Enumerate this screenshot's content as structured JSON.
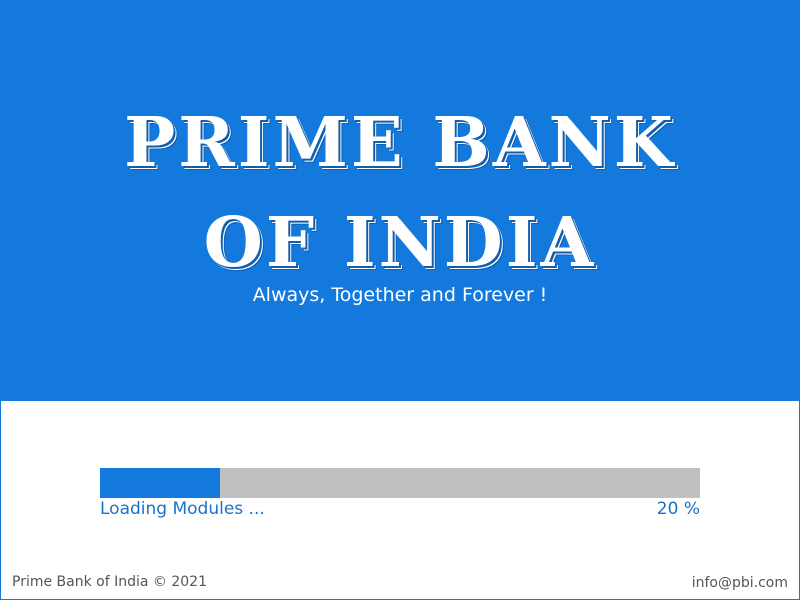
{
  "banner": {
    "title_line1": "PRIME BANK",
    "title_line2": "OF INDIA",
    "tagline": "Always, Together and Forever !",
    "color": "#1379dc"
  },
  "progress": {
    "value": 0.2,
    "status_text": "Loading Modules ...",
    "percent_label": "20 %",
    "fill_color": "#1379dc",
    "track_color": "#c0c0c0"
  },
  "footer": {
    "copyright": "Prime Bank of India © 2021",
    "email": "info@pbi.com"
  }
}
